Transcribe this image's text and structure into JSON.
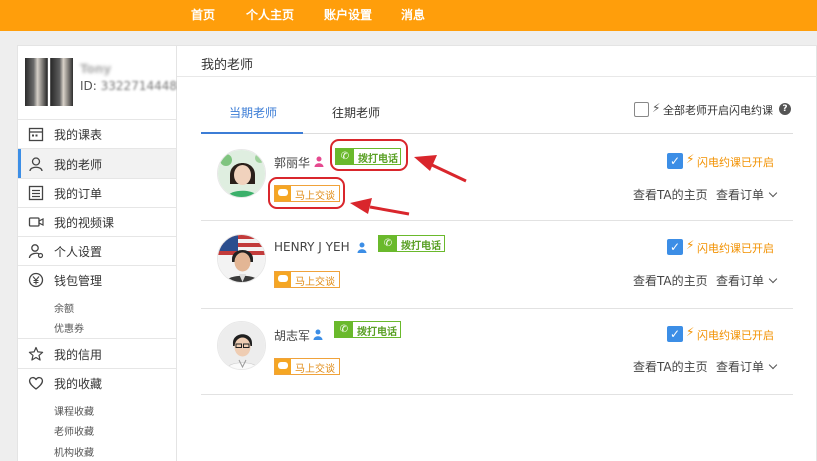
{
  "nav": [
    "首页",
    "个人主页",
    "账户设置",
    "消息"
  ],
  "profile": {
    "name": "Tony",
    "id_label": "ID:",
    "id_value": "3322714448"
  },
  "sidebar": {
    "items": [
      {
        "label": "我的课表",
        "icon": "calendar-icon"
      },
      {
        "label": "我的老师",
        "icon": "user-icon"
      },
      {
        "label": "我的订单",
        "icon": "list-icon"
      },
      {
        "label": "我的视频课",
        "icon": "video-icon"
      },
      {
        "label": "个人设置",
        "icon": "person-settings-icon"
      },
      {
        "label": "钱包管理",
        "icon": "yen-icon"
      },
      {
        "label": "我的信用",
        "icon": "star-icon"
      },
      {
        "label": "我的收藏",
        "icon": "heart-icon"
      }
    ],
    "wallet_sub": [
      "余额",
      "优惠券"
    ],
    "fav_sub": [
      "课程收藏",
      "老师收藏",
      "机构收藏"
    ]
  },
  "main": {
    "title": "我的老师",
    "tabs": [
      "当期老师",
      "往期老师"
    ],
    "all_flash_label": "全部老师开启闪电约课",
    "help": "?"
  },
  "teachers": [
    {
      "name": "郭丽华",
      "gender": "female",
      "gender_color": "#e5498f"
    },
    {
      "name": "HENRY J YEH",
      "gender": "male",
      "gender_color": "#3c8ee6"
    },
    {
      "name": "胡志军",
      "gender": "male",
      "gender_color": "#3c8ee6"
    }
  ],
  "labels": {
    "call": "拨打电话",
    "chat": "马上交谈",
    "flash_on": "闪电约课已开启",
    "view_home": "查看TA的主页",
    "view_orders": "查看订单",
    "check": "✓",
    "bolt": "⚡"
  },
  "colors": {
    "nav_bg": "#ff9e0b",
    "accent_blue": "#3c7dd6",
    "call_green": "#6ab92c",
    "chat_orange": "#f5a623",
    "highlight_red": "#d9262c"
  }
}
